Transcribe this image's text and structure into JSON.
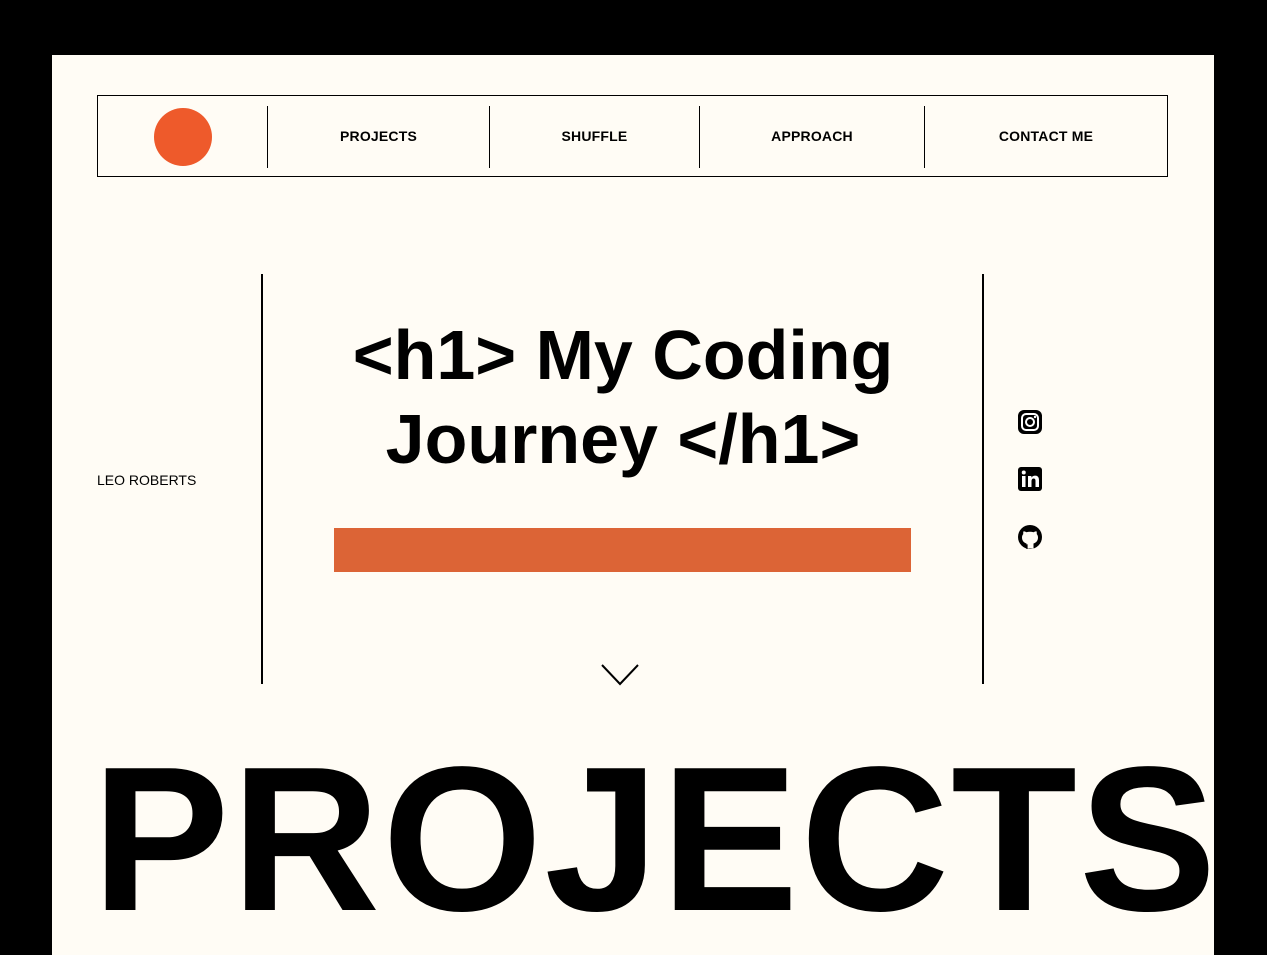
{
  "nav": {
    "items": [
      "PROJECTS",
      "SHUFFLE",
      "APPROACH",
      "CONTACT ME"
    ],
    "logo_color": "#ee5a2b"
  },
  "hero": {
    "author": "LEO ROBERTS",
    "title_line1": "<h1> My Coding",
    "title_line2": "Journey </h1>",
    "accent_bar_color": "#dc6436",
    "scroll_icon": "chevron-down-icon"
  },
  "social": [
    {
      "name": "instagram-icon"
    },
    {
      "name": "linkedin-icon"
    },
    {
      "name": "github-icon"
    }
  ],
  "section": {
    "heading": "PROJECTS"
  },
  "colors": {
    "page_bg": "#fffcf5",
    "frame_bg": "#000000"
  }
}
